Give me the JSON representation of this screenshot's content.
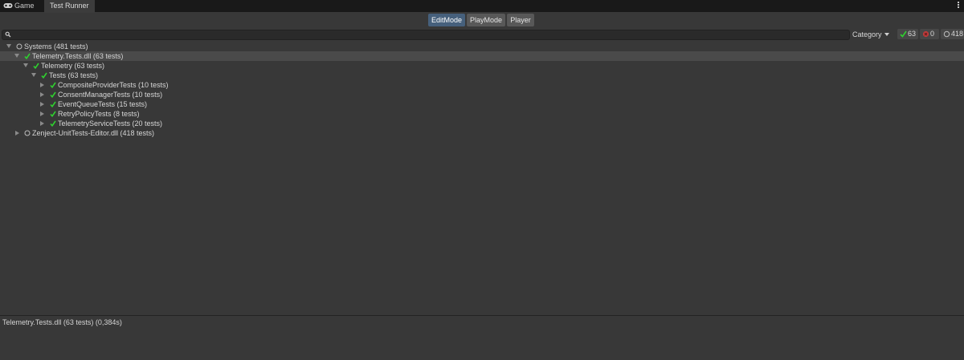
{
  "tabs": {
    "game": "Game",
    "test_runner": "Test Runner"
  },
  "modes": {
    "edit": "EditMode",
    "play": "PlayMode",
    "player": "Player",
    "active": "EditMode"
  },
  "search": {
    "placeholder": ""
  },
  "filter": {
    "category": "Category"
  },
  "counters": {
    "passed": "63",
    "failed": "0",
    "skipped": "418"
  },
  "tree": [
    {
      "label": "Systems (481 tests)",
      "status": "none",
      "expanded": true
    },
    {
      "label": "Telemetry.Tests.dll (63 tests)",
      "status": "passed",
      "expanded": true,
      "selected": true
    },
    {
      "label": "Telemetry (63 tests)",
      "status": "passed",
      "expanded": true
    },
    {
      "label": "Tests (63 tests)",
      "status": "passed",
      "expanded": true
    },
    {
      "label": "CompositeProviderTests (10 tests)",
      "status": "passed",
      "expanded": false
    },
    {
      "label": "ConsentManagerTests (10 tests)",
      "status": "passed",
      "expanded": false
    },
    {
      "label": "EventQueueTests (15 tests)",
      "status": "passed",
      "expanded": false
    },
    {
      "label": "RetryPolicyTests (8 tests)",
      "status": "passed",
      "expanded": false
    },
    {
      "label": "TelemetryServiceTests (20 tests)",
      "status": "passed",
      "expanded": false
    },
    {
      "label": "Zenject-UnitTests-Editor.dll (418 tests)",
      "status": "none",
      "expanded": false
    }
  ],
  "status_text": "Telemetry.Tests.dll (63 tests) (0,384s)",
  "colors": {
    "accent": "#46607c",
    "pass": "#2fd12f",
    "fail": "#c23b3b",
    "background": "#383838"
  },
  "icons": {
    "game": "gamepad-icon",
    "search": "search-icon",
    "pass": "check-icon",
    "fail": "fail-icon",
    "none": "circle-icon",
    "menu": "kebab-menu-icon"
  }
}
